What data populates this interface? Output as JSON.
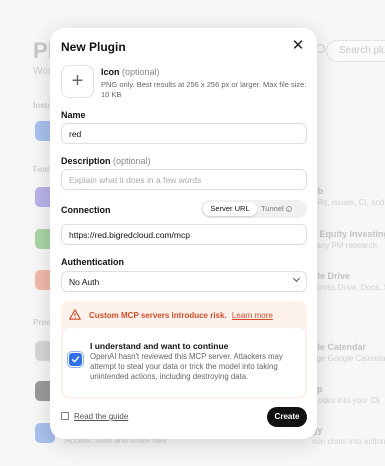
{
  "background": {
    "title": "Plu",
    "subtitle": "Wor",
    "search_placeholder": "Search plugi",
    "sections": [
      "Insta",
      "Feat",
      "Prod"
    ],
    "cards": [
      {
        "title": "ub",
        "desc": "PRs, issues, CI, and"
      },
      {
        "title": "c Equity Investing",
        "desc": "pany PM research"
      },
      {
        "title": "gle Drive",
        "desc": "across Drive, Docs, S"
      },
      {
        "title": "gle Calendar",
        "desc": "age Google Calendar"
      },
      {
        "title": "Jp",
        "desc": "Codex into your Cli"
      },
      {
        "title": "gy",
        "desc": "ruin chats into actions"
      }
    ],
    "bottom_desc": "Access, save and share files"
  },
  "modal": {
    "title": "New Plugin",
    "close_glyph": "✕",
    "icon": {
      "add_glyph": "+",
      "label": "Icon",
      "optional": "(optional)",
      "help": "PNG only. Best results at 256 x 256 px or larger. Max file size: 10 KB"
    },
    "name": {
      "label": "Name",
      "value": "red"
    },
    "description": {
      "label": "Description",
      "optional": "(optional)",
      "placeholder": "Explain what it does in a few words"
    },
    "connection": {
      "label": "Connection",
      "segments": [
        "Server URL",
        "Tunnel"
      ],
      "selected": "Server URL",
      "value": "https://red.bigredcloud.com/mcp"
    },
    "authentication": {
      "label": "Authentication",
      "value": "No Auth"
    },
    "warning": {
      "text": "Custom MCP servers introduce risk.",
      "link": "Learn more",
      "checkbox_checked": true,
      "checkbox_title": "I understand and want to continue",
      "checkbox_body": "OpenAI hasn't reviewed this MCP server. Attackers may attempt to steal your data or trick the model into taking unintended actions, including destroying data."
    },
    "guide_label": "Read the guide",
    "create_label": "Create"
  },
  "colors": {
    "accent": "#2f6fe8",
    "warning": "#d14d27",
    "warning_bg": "#fdf1ec",
    "primary_button": "#111111"
  }
}
